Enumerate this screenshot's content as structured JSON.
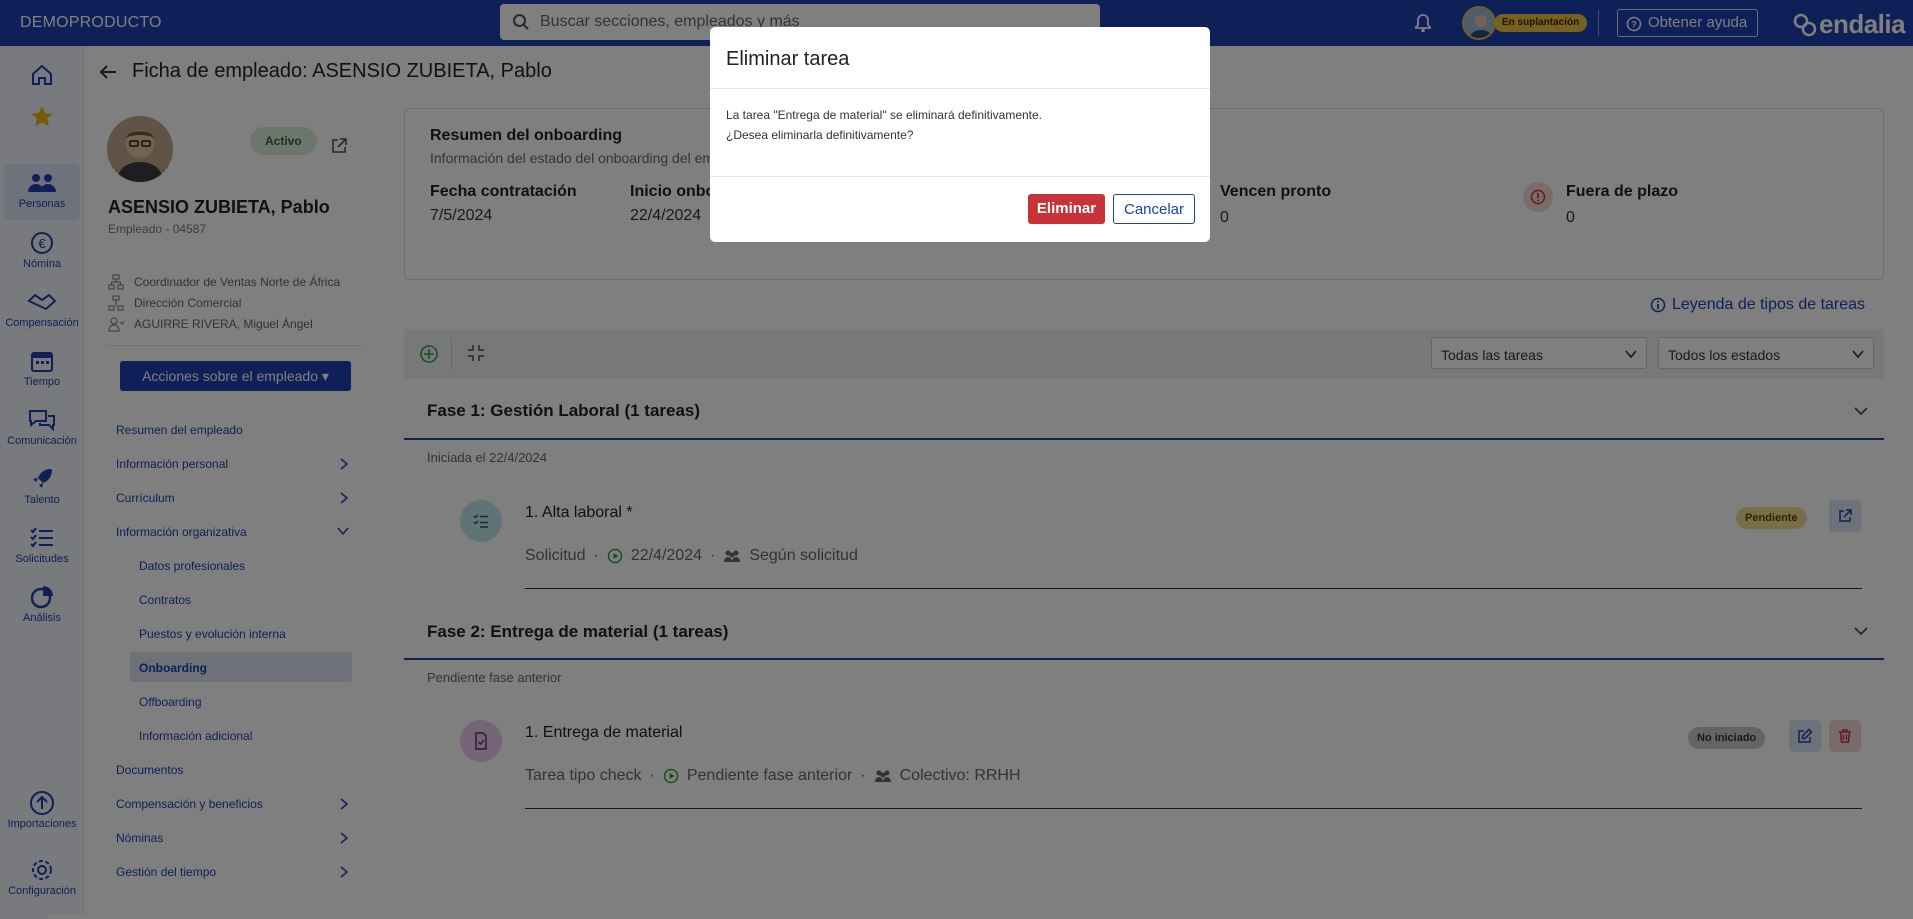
{
  "topbar": {
    "brand": "DEMOPRODUCTO",
    "search_placeholder": "Buscar secciones, empleados y más",
    "impersonation_badge": "En suplantación",
    "help_label": "Obtener ayuda",
    "logo_text": "endalia"
  },
  "rail": {
    "items": [
      {
        "label": "",
        "icon": "home-icon"
      },
      {
        "label": "",
        "icon": "star-icon"
      },
      {
        "label": "Personas",
        "icon": "people-icon"
      },
      {
        "label": "Nómina",
        "icon": "euro-icon"
      },
      {
        "label": "Compensación",
        "icon": "handshake-icon"
      },
      {
        "label": "Tiempo",
        "icon": "calendar-icon"
      },
      {
        "label": "Comunicación",
        "icon": "chat-icon"
      },
      {
        "label": "Talento",
        "icon": "rocket-icon"
      },
      {
        "label": "Solicitudes",
        "icon": "checklist-icon"
      },
      {
        "label": "Análisis",
        "icon": "pie-chart-icon"
      },
      {
        "label": "Importaciones",
        "icon": "upload-icon"
      },
      {
        "label": "Configuración",
        "icon": "gear-icon"
      }
    ]
  },
  "page": {
    "title": "Ficha de empleado: ASENSIO ZUBIETA, Pablo"
  },
  "employee": {
    "status": "Activo",
    "name": "ASENSIO ZUBIETA, Pablo",
    "subtitle": "Empleado - 04587",
    "position": "Coordinador de Ventas Norte de África",
    "department": "Dirección Comercial",
    "manager": "AGUIRRE RIVERA, Miguel Ángel",
    "actions_label": "Acciones sobre el empleado"
  },
  "sidenav": {
    "items": [
      {
        "label": "Resumen del empleado"
      },
      {
        "label": "Información personal"
      },
      {
        "label": "Currículum"
      },
      {
        "label": "Información organizativa"
      },
      {
        "label": "Datos profesionales"
      },
      {
        "label": "Contratos"
      },
      {
        "label": "Puestos y evolución interna"
      },
      {
        "label": "Onboarding"
      },
      {
        "label": "Offboarding"
      },
      {
        "label": "Información adicional"
      },
      {
        "label": "Documentos"
      },
      {
        "label": "Compensación y beneficios"
      },
      {
        "label": "Nóminas"
      },
      {
        "label": "Gestión del tiempo"
      }
    ]
  },
  "summary": {
    "title": "Resumen del onboarding",
    "subtitle": "Información del estado del onboarding del em",
    "hire_label": "Fecha contratación",
    "hire_value": "7/5/2024",
    "start_label": "Inicio onbo",
    "start_value": "22/4/2024",
    "due_soon_label": "Vencen pronto",
    "due_soon_value": "0",
    "overdue_label": "Fuera de plazo",
    "overdue_value": "0"
  },
  "legend_link": "Leyenda de tipos de tareas",
  "filters": {
    "tasks": "Todas las tareas",
    "states": "Todos los estados"
  },
  "phases": [
    {
      "title": "Fase 1: Gestión Laboral (1 tareas)",
      "note": "Iniciada el 22/4/2024",
      "task": {
        "title": "1. Alta laboral *",
        "type": "Solicitud",
        "date": "22/4/2024",
        "assignee": "Según solicitud",
        "status": "Pendiente"
      }
    },
    {
      "title": "Fase 2: Entrega de material (1 tareas)",
      "note": "Pendiente fase anterior",
      "task": {
        "title": "1. Entrega de material",
        "type": "Tarea tipo check",
        "date": "Pendiente fase anterior",
        "assignee": "Colectivo: RRHH",
        "status": "No iniciado"
      }
    }
  ],
  "modal": {
    "title": "Eliminar tarea",
    "line1": "La tarea \"Entrega de material\" se eliminará definitivamente.",
    "line2": "¿Desea eliminarla definitivamente?",
    "confirm": "Eliminar",
    "cancel": "Cancelar"
  },
  "colors": {
    "brand": "#1e40b0",
    "danger": "#c8333a",
    "pending": "#f3dc8e",
    "not_started": "#c9c9c9"
  }
}
